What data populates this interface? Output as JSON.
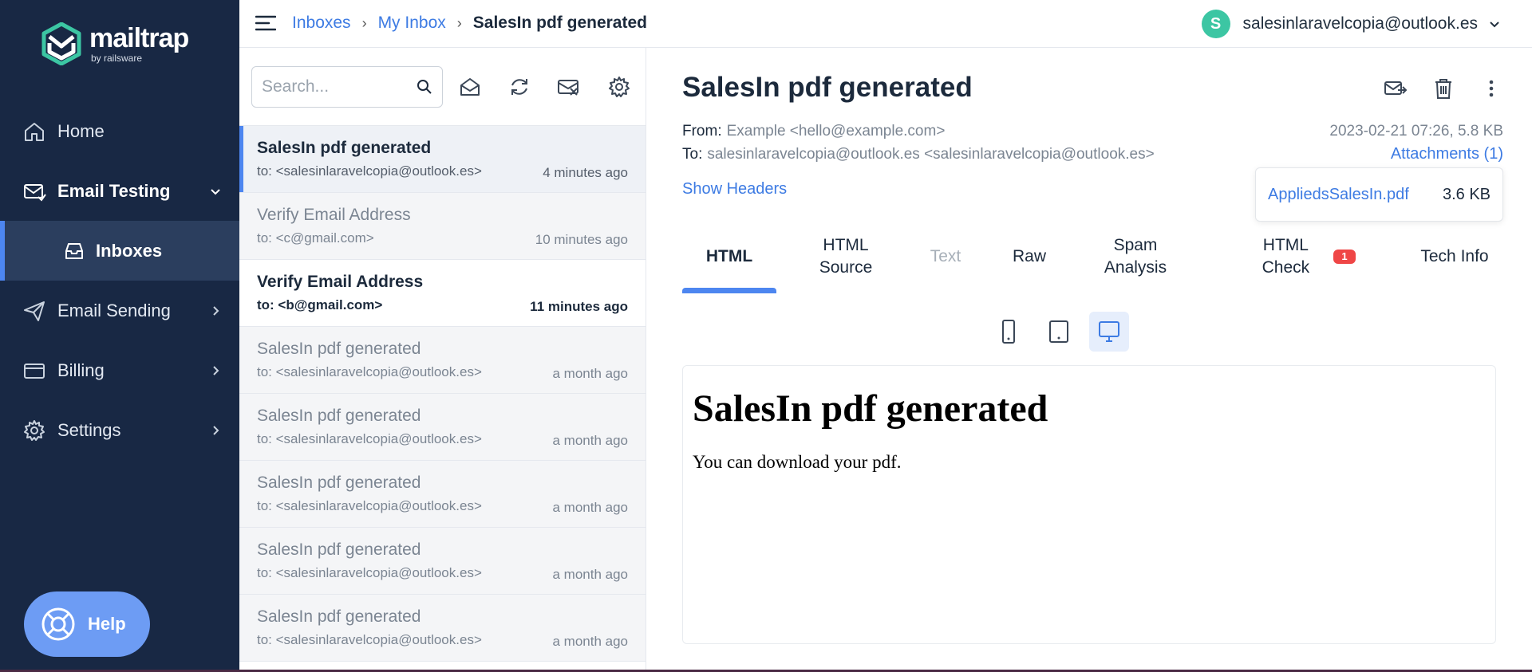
{
  "brand": {
    "name": "mailtrap",
    "sub": "by railsware",
    "color": "#3cc6a3"
  },
  "sidebar": {
    "items": [
      {
        "label": "Home",
        "icon": "home-icon"
      },
      {
        "label": "Email Testing",
        "icon": "email-testing-icon",
        "expanded": true
      },
      {
        "label": "Inboxes",
        "icon": "inbox-icon",
        "active": true
      },
      {
        "label": "Email Sending",
        "icon": "send-icon"
      },
      {
        "label": "Billing",
        "icon": "billing-icon"
      },
      {
        "label": "Settings",
        "icon": "gear-icon"
      }
    ],
    "help_label": "Help"
  },
  "header": {
    "breadcrumbs": [
      "Inboxes",
      "My Inbox",
      "SalesIn pdf generated"
    ],
    "user_initial": "S",
    "user_email": "salesinlaravelcopia@outlook.es"
  },
  "list": {
    "search_placeholder": "Search...",
    "messages": [
      {
        "subject": "SalesIn pdf generated",
        "to": "to: <salesinlaravelcopia@outlook.es>",
        "time": "4 minutes ago",
        "state": "selected"
      },
      {
        "subject": "Verify Email Address",
        "to": "to: <c@gmail.com>",
        "time": "10 minutes ago",
        "state": "read"
      },
      {
        "subject": "Verify Email Address",
        "to": "to: <b@gmail.com>",
        "time": "11 minutes ago",
        "state": "unread"
      },
      {
        "subject": "SalesIn pdf generated",
        "to": "to: <salesinlaravelcopia@outlook.es>",
        "time": "a month ago",
        "state": "read"
      },
      {
        "subject": "SalesIn pdf generated",
        "to": "to: <salesinlaravelcopia@outlook.es>",
        "time": "a month ago",
        "state": "read"
      },
      {
        "subject": "SalesIn pdf generated",
        "to": "to: <salesinlaravelcopia@outlook.es>",
        "time": "a month ago",
        "state": "read"
      },
      {
        "subject": "SalesIn pdf generated",
        "to": "to: <salesinlaravelcopia@outlook.es>",
        "time": "a month ago",
        "state": "read"
      },
      {
        "subject": "SalesIn pdf generated",
        "to": "to: <salesinlaravelcopia@outlook.es>",
        "time": "a month ago",
        "state": "read"
      }
    ]
  },
  "detail": {
    "title": "SalesIn pdf generated",
    "from_label": "From:",
    "from_value": "Example <hello@example.com>",
    "to_label": "To:",
    "to_value": "salesinlaravelcopia@outlook.es <salesinlaravelcopia@outlook.es>",
    "date_size": "2023-02-21 07:26, 5.8 KB",
    "attachments_label": "Attachments (1)",
    "show_headers": "Show Headers",
    "attachment": {
      "name": "AppliedsSalesIn.pdf",
      "size": "3.6 KB"
    },
    "tabs": [
      {
        "label": "HTML",
        "state": "active"
      },
      {
        "label": "HTML Source",
        "state": "normal"
      },
      {
        "label": "Text",
        "state": "disabled"
      },
      {
        "label": "Raw",
        "state": "normal"
      },
      {
        "label": "Spam Analysis",
        "state": "normal"
      },
      {
        "label": "HTML Check",
        "state": "normal",
        "badge": "1"
      },
      {
        "label": "Tech Info",
        "state": "normal"
      }
    ],
    "devices": [
      "mobile-icon",
      "tablet-icon",
      "desktop-icon"
    ],
    "selected_device": "desktop",
    "preview": {
      "heading": "SalesIn pdf generated",
      "body": "You can download your pdf."
    }
  },
  "colors": {
    "sidebar": "#182844",
    "accent": "#4d86f0",
    "link": "#3d7be3",
    "badge": "#ef4646"
  }
}
